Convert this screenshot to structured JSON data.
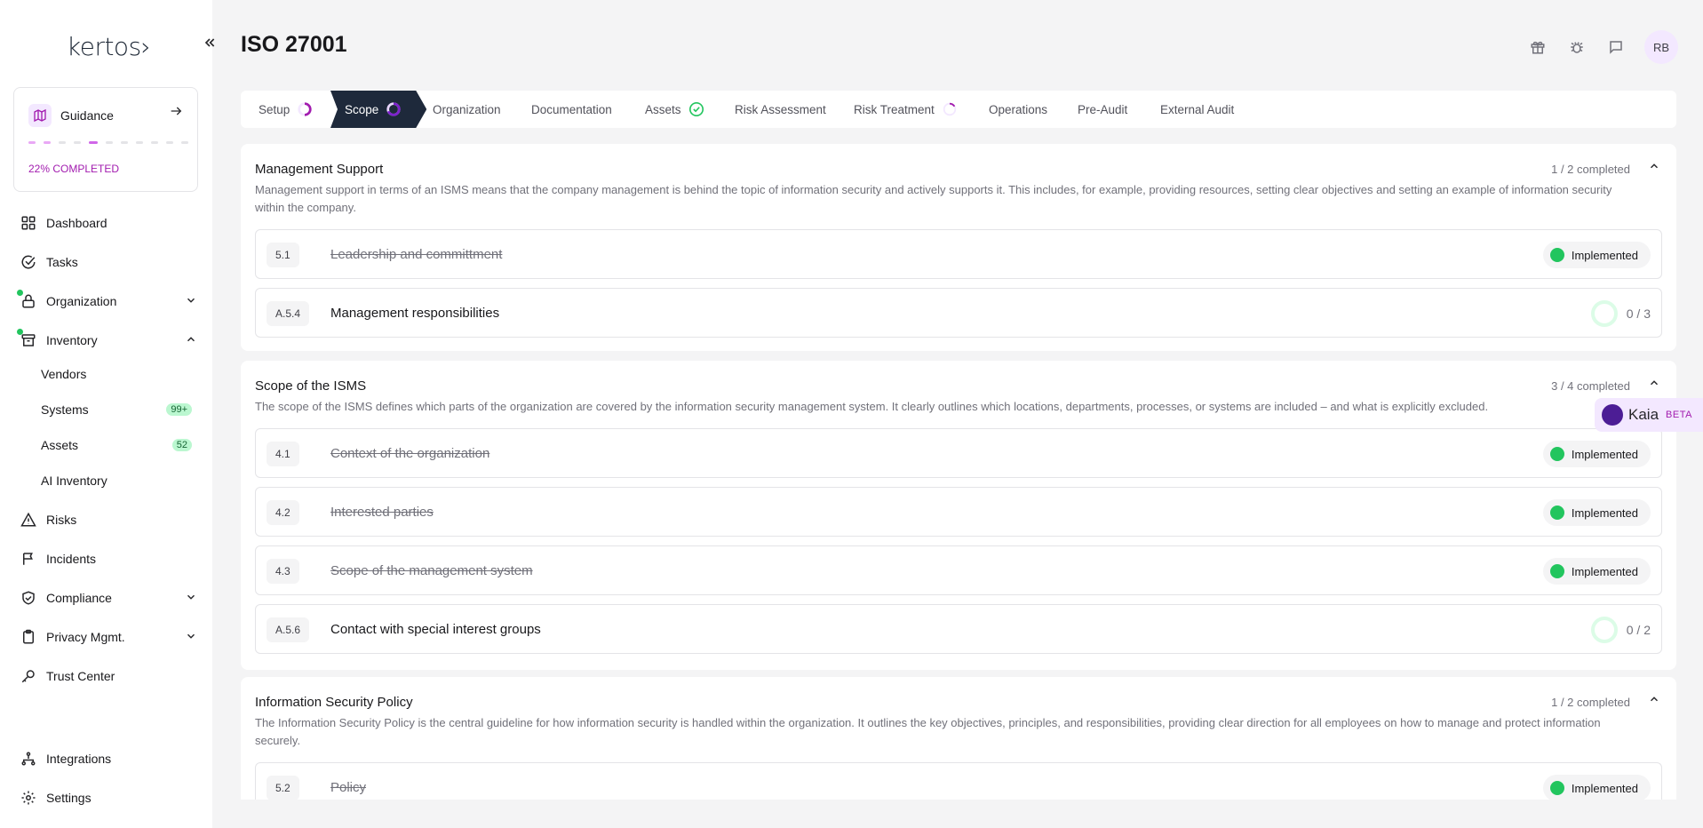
{
  "app": {
    "logo": "kertos›",
    "page_title": "ISO 27001",
    "avatar_initials": "RB",
    "accent": "#a21caf"
  },
  "sidebar": {
    "guidance": {
      "label": "Guidance",
      "progress": "22% COMPLETED",
      "steps_done": 3,
      "steps_total": 11
    },
    "items": [
      {
        "label": "Dashboard",
        "icon": "dashboard-icon"
      },
      {
        "label": "Tasks",
        "icon": "check-circle-icon"
      },
      {
        "label": "Organization",
        "icon": "lock-icon"
      },
      {
        "label": "Inventory",
        "icon": "archive-icon"
      },
      {
        "label": "Risks",
        "icon": "warning-icon"
      },
      {
        "label": "Incidents",
        "icon": "flag-icon"
      },
      {
        "label": "Compliance",
        "icon": "shield-check-icon"
      },
      {
        "label": "Privacy Mgmt.",
        "icon": "clipboard-icon"
      },
      {
        "label": "Trust Center",
        "icon": "key-icon"
      },
      {
        "label": "Integrations",
        "icon": "integrations-icon"
      },
      {
        "label": "Settings",
        "icon": "gear-icon"
      }
    ],
    "inventory_sub": [
      {
        "label": "Vendors",
        "badge": ""
      },
      {
        "label": "Systems",
        "badge": "99+"
      },
      {
        "label": "Assets",
        "badge": "52"
      },
      {
        "label": "AI Inventory",
        "badge": ""
      }
    ]
  },
  "stepper": [
    {
      "label": "Setup"
    },
    {
      "label": "Scope"
    },
    {
      "label": "Organization"
    },
    {
      "label": "Documentation"
    },
    {
      "label": "Assets"
    },
    {
      "label": "Risk Assessment"
    },
    {
      "label": "Risk Treatment"
    },
    {
      "label": "Operations"
    },
    {
      "label": "Pre-Audit"
    },
    {
      "label": "External Audit"
    }
  ],
  "sections": [
    {
      "title": "Management Support",
      "count": "1 / 2 completed",
      "description": "Management support in terms of an ISMS means that the company management is behind the topic of information security and actively supports it. This includes, for example, providing resources, setting clear objectives and setting an example of information security within the company.",
      "rows": [
        {
          "code": "5.1",
          "title": "Leadership and committment",
          "status": "Implemented"
        },
        {
          "code": "A.5.4",
          "title": "Management responsibilities",
          "progress": "0 / 3"
        }
      ]
    },
    {
      "title": "Scope of the ISMS",
      "count": "3 / 4 completed",
      "description": "The scope of the ISMS defines which parts of the organization are covered by the information security management system. It clearly outlines which locations, departments, processes, or systems are included – and what is explicitly excluded.",
      "rows": [
        {
          "code": "4.1",
          "title": "Context of the organization",
          "status": "Implemented"
        },
        {
          "code": "4.2",
          "title": "Interested parties",
          "status": "Implemented"
        },
        {
          "code": "4.3",
          "title": "Scope of the management system",
          "status": "Implemented"
        },
        {
          "code": "A.5.6",
          "title": "Contact with special interest groups",
          "progress": "0 / 2"
        }
      ]
    },
    {
      "title": "Information Security Policy",
      "count": "1 / 2 completed",
      "description": "The Information Security Policy is the central guideline for how information security is handled within the organization. It outlines the key objectives, principles, and responsibilities, providing clear direction for all employees on how to manage and protect information securely.",
      "rows": [
        {
          "code": "5.2",
          "title": "Policy",
          "status": "Implemented"
        }
      ]
    }
  ],
  "kaia": {
    "name": "Kaia",
    "tag": "BETA"
  }
}
